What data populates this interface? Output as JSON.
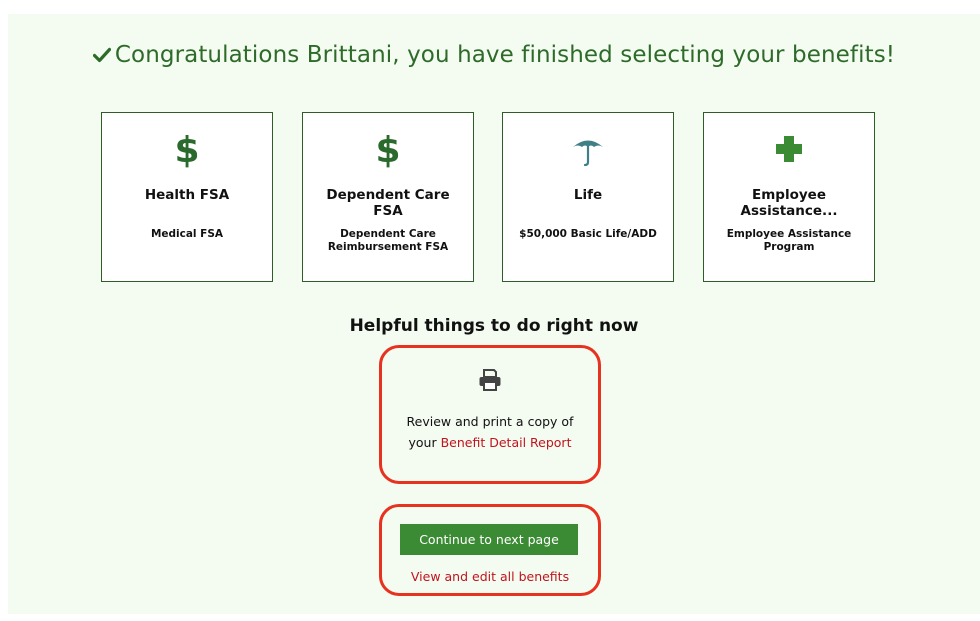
{
  "header": {
    "title": "Congratulations Brittani, you have finished selecting your benefits!"
  },
  "benefits": [
    {
      "name": "Health FSA",
      "detail": "Medical FSA",
      "icon": "dollar-icon"
    },
    {
      "name": "Dependent Care FSA",
      "detail": "Dependent Care Reimbursement FSA",
      "icon": "dollar-icon"
    },
    {
      "name": "Life",
      "detail": "$50,000 Basic Life/ADD",
      "icon": "umbrella-icon"
    },
    {
      "name": "Employee Assistance...",
      "detail": "Employee Assistance Program",
      "icon": "plus-icon"
    }
  ],
  "helpful": {
    "heading": "Helpful things to do right now",
    "print_text_line1": "Review and print a copy of",
    "print_text_prefix": "your ",
    "print_link": "Benefit Detail Report"
  },
  "actions": {
    "continue_label": "Continue to next page",
    "edit_link": "View and edit all benefits"
  },
  "colors": {
    "accent_green": "#3b8b34",
    "heading_green": "#2e6b2a",
    "icon_green": "#2a6a2c",
    "umbrella_teal": "#3f7f86",
    "link_red": "#c0141e",
    "highlight_red": "#e6321e",
    "panel_bg": "#f4fbf1"
  }
}
